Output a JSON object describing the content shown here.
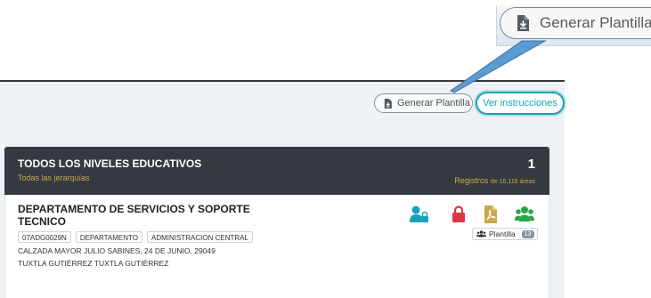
{
  "callout": {
    "label": "Generar Plantilla"
  },
  "toolbar": {
    "generar_label": "Generar Plantilla",
    "instrucciones_label": "Ver instrucciones"
  },
  "summary": {
    "title": "TODOS LOS NIVELES EDUCATIVOS",
    "subtitle": "Todas las jerarquías",
    "count": "1",
    "registros_label": "Registros",
    "registros_detail": "de 16,116 áreas"
  },
  "record": {
    "title": "DEPARTAMENTO DE SERVICIOS Y SOPORTE TECNICO",
    "tags": [
      "07ADG0029N",
      "DEPARTAMENTO",
      "ADMINISTRACION CENTRAL"
    ],
    "address_line1": "CALZADA MAYOR JULIO SABINES, 24 DE JUNIO, 29049",
    "address_line2": "TUXTLA GUTIÉRREZ TUXTLA GUTIÉRREZ",
    "plantilla_label": "Plantilla",
    "plantilla_count": "13",
    "icons": [
      "user-lock-icon",
      "lock-icon",
      "pdf-file-icon",
      "users-icon"
    ]
  },
  "colors": {
    "teal": "#17a2b8",
    "red": "#dc3545",
    "gold": "#c9a94a",
    "green": "#28a745",
    "dark": "#343a40"
  }
}
